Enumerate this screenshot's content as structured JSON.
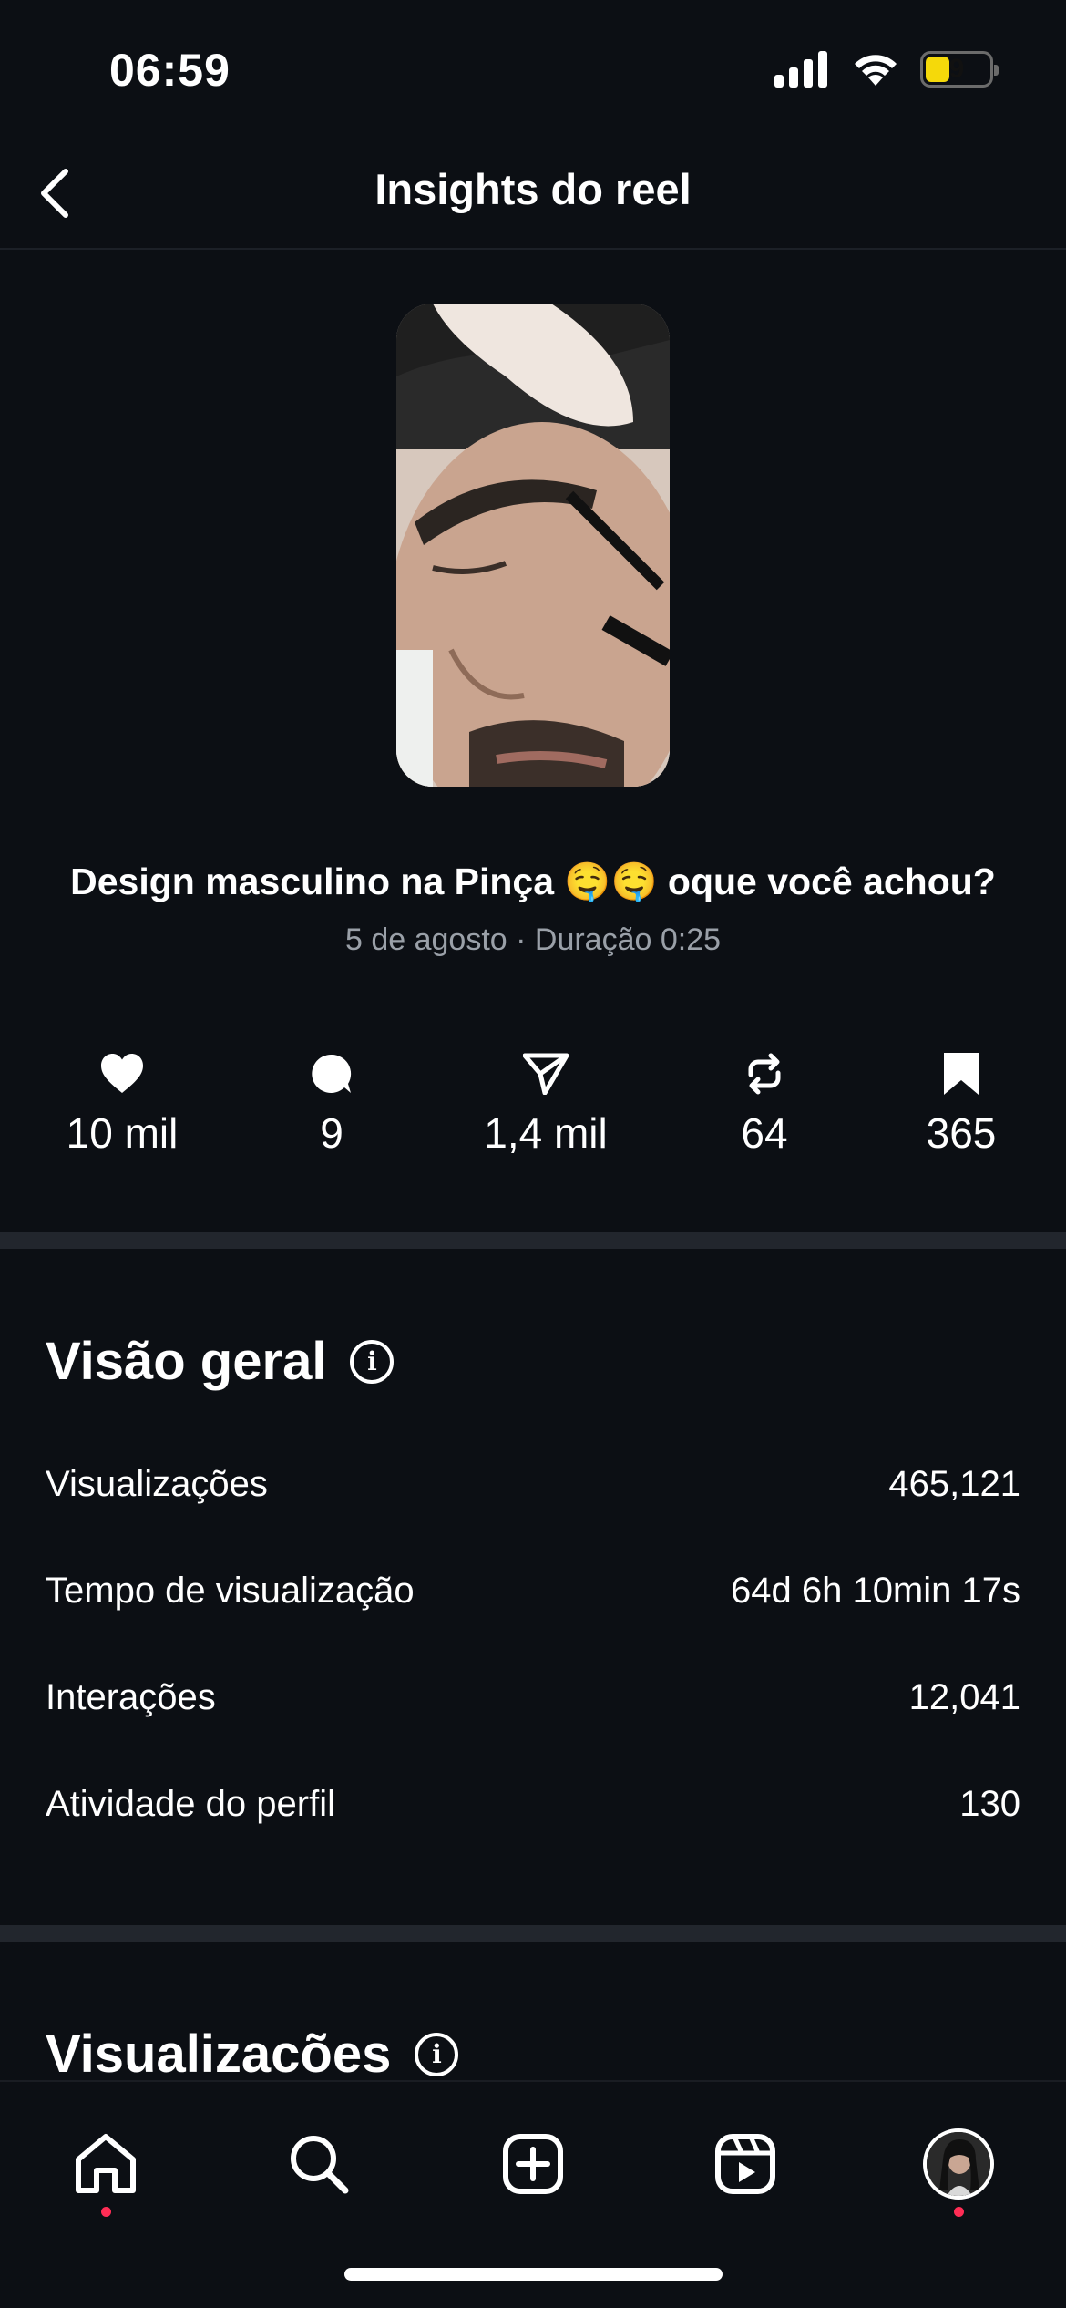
{
  "status_bar": {
    "time": "06:59",
    "battery": "9"
  },
  "header": {
    "title": "Insights do reel"
  },
  "reel": {
    "caption": "Design masculino na Pinça 🤤🤤 oque você achou?",
    "subtitle": "5 de agosto · Duração 0:25"
  },
  "stats": [
    {
      "icon": "heart-icon",
      "value": "10 mil"
    },
    {
      "icon": "comment-icon",
      "value": "9"
    },
    {
      "icon": "send-icon",
      "value": "1,4 mil"
    },
    {
      "icon": "repost-icon",
      "value": "64"
    },
    {
      "icon": "bookmark-icon",
      "value": "365"
    }
  ],
  "overview": {
    "title": "Visão geral",
    "rows": [
      {
        "label": "Visualizações",
        "value": "465,121"
      },
      {
        "label": "Tempo de visualização",
        "value": "64d 6h 10min 17s"
      },
      {
        "label": "Interações",
        "value": "12,041"
      },
      {
        "label": "Atividade do perfil",
        "value": "130"
      }
    ]
  },
  "views_section": {
    "title": "Visualizacões"
  },
  "nav": [
    {
      "icon": "home-icon",
      "active_dot": true
    },
    {
      "icon": "search-icon",
      "active_dot": false
    },
    {
      "icon": "create-icon",
      "active_dot": false
    },
    {
      "icon": "reels-icon",
      "active_dot": false
    },
    {
      "icon": "profile-avatar",
      "active_dot": true
    }
  ],
  "colors": {
    "background": "#0c0f14",
    "divider": "#22262d",
    "notification_dot": "#ff2d55",
    "secondary_text": "#9aa0a8"
  }
}
